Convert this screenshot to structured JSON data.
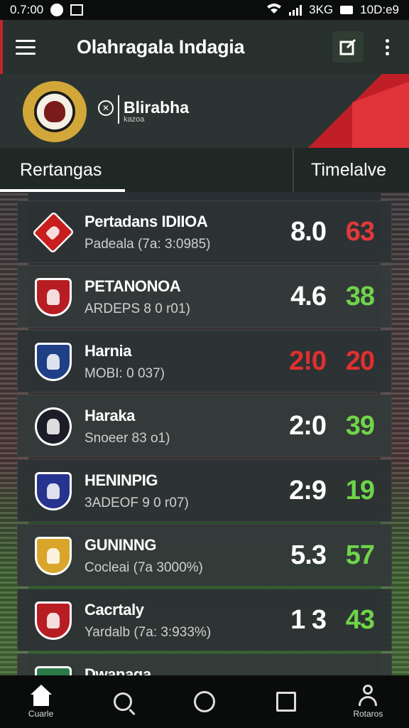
{
  "status_bar": {
    "time": "0.7:00",
    "network": "3KG",
    "clock": "10D:e9"
  },
  "app_bar": {
    "title": "Olahragala Indagia"
  },
  "header": {
    "partner_name": "Blirabha",
    "partner_sub": "kazoa"
  },
  "tabs": [
    {
      "label": "Rertangas",
      "active": true
    },
    {
      "label": "Timelalve",
      "active": false
    }
  ],
  "matches": [
    {
      "team": "Pertadans IDIIOA",
      "sub": "Padeala (7a: 3:0985)",
      "score_a": "8.0",
      "score_b": "63",
      "color_a": "#ffffff",
      "color_b": "#e2393a",
      "badge_color": "#c81e1e",
      "badge_shape": "diamond",
      "badge_icon": "diamond-crest-icon"
    },
    {
      "team": "PETANONOA",
      "sub": "ARDEPS 8 0 r01)",
      "score_a": "4.6",
      "score_b": "38",
      "color_a": "#ffffff",
      "color_b": "#6fd44a",
      "badge_color": "#b81d24",
      "badge_shape": "shield",
      "badge_icon": "shield-crest-icon"
    },
    {
      "team": "Harnia",
      "sub": "MOBI: 0 037)",
      "score_a": "2!0",
      "score_b": "20",
      "color_a": "#e0302f",
      "color_b": "#e0302f",
      "badge_color": "#1f3f86",
      "badge_shape": "shield",
      "badge_icon": "shield-crest-icon"
    },
    {
      "team": "Haraka",
      "sub": "Snoeer 83 o1)",
      "score_a": "2:0",
      "score_b": "39",
      "color_a": "#ffffff",
      "color_b": "#6fd44a",
      "badge_color": "#1d1d2a",
      "badge_shape": "round",
      "badge_icon": "round-crest-icon"
    },
    {
      "team": "HENINPIG",
      "sub": "3ADEOF 9 0 r07)",
      "score_a": "2:9",
      "score_b": "19",
      "color_a": "#ffffff",
      "color_b": "#6fd44a",
      "badge_color": "#26338f",
      "badge_shape": "shield",
      "badge_icon": "shield-crest-icon"
    },
    {
      "team": "GUNINNG",
      "sub": "Cocleai (7a 3000%)",
      "score_a": "5.3",
      "score_b": "57",
      "color_a": "#ffffff",
      "color_b": "#6fd44a",
      "badge_color": "#d9a52a",
      "badge_shape": "shield",
      "badge_icon": "garuda-crest-icon"
    },
    {
      "team": "Cacrtaly",
      "sub": "Yardalb (7a: 3:933%)",
      "score_a": "1 3",
      "score_b": "43",
      "color_a": "#ffffff",
      "color_b": "#6fd44a",
      "badge_color": "#b81d24",
      "badge_shape": "shield",
      "badge_icon": "shield-crest-icon"
    },
    {
      "team": "Dwanaga",
      "sub": "",
      "score_a": "",
      "score_b": "",
      "color_a": "#ffffff",
      "color_b": "#6fd44a",
      "badge_color": "#2b7a4a",
      "badge_shape": "shield",
      "badge_icon": "shield-crest-icon"
    }
  ],
  "bottom_nav": [
    {
      "icon": "home-icon",
      "label": "Cuarle"
    },
    {
      "icon": "search-icon",
      "label": ""
    },
    {
      "icon": "circle-icon",
      "label": ""
    },
    {
      "icon": "square-icon",
      "label": ""
    },
    {
      "icon": "person-icon",
      "label": "Rotaros"
    }
  ]
}
